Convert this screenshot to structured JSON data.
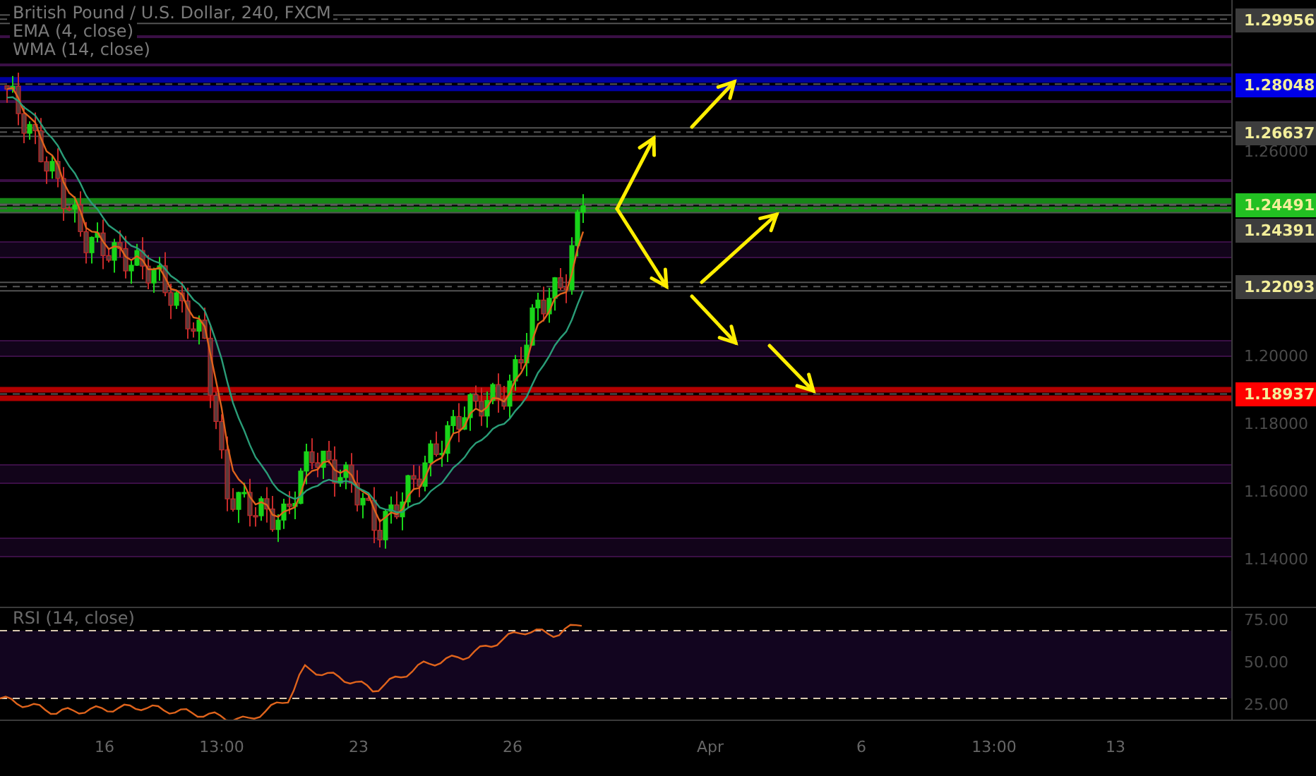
{
  "legend": [
    {
      "text": "British Pound / U.S. Dollar, 240, FXCM"
    },
    {
      "text": "EMA (4, close)"
    },
    {
      "text": "WMA (14, close)"
    }
  ],
  "price_axis": {
    "ticks": [
      "1.26000",
      "1.20000",
      "1.18000",
      "1.16000",
      "1.14000"
    ]
  },
  "price_tags": [
    {
      "label": "1.29956",
      "color": "#3d3d3d"
    },
    {
      "label": "1.28048",
      "color": "#0000e6"
    },
    {
      "label": "1.26637",
      "color": "#3d3d3d"
    },
    {
      "label": "1.24491",
      "color": "#22c022"
    },
    {
      "label": "1.24391",
      "color": "#3d3d3d"
    },
    {
      "label": "1.22093",
      "color": "#3d3d3d"
    },
    {
      "label": "1.18937",
      "color": "#ff0000"
    }
  ],
  "rsi": {
    "label": "RSI (14, close)",
    "ticks": [
      "75.00",
      "50.00",
      "25.00"
    ]
  },
  "time_axis": [
    "16",
    "13:00",
    "23",
    "26",
    "Apr",
    "6",
    "13:00",
    "13"
  ]
}
